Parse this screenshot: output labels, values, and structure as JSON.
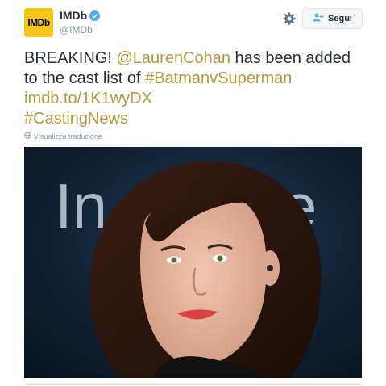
{
  "header": {
    "avatar_text": "IMDb",
    "display_name": "IMDb",
    "handle": "@IMDb",
    "follow_label": "Segui"
  },
  "tweet": {
    "part1": "BREAKING! ",
    "mention": "@LaurenCohan",
    "part2": " has been added to the cast list of ",
    "hashtag1": "#BatmanvSuperman",
    "space": " ",
    "url": "imdb.to/1K1wyDX",
    "hashtag2": "#CastingNews"
  },
  "translate_label": "Visualizza traduzione",
  "photo": {
    "backdrop_text": "In",
    "backdrop_text2": "e"
  },
  "colors": {
    "link": "#b3993a",
    "verified": "#55acee",
    "brand": "#f5c518"
  }
}
